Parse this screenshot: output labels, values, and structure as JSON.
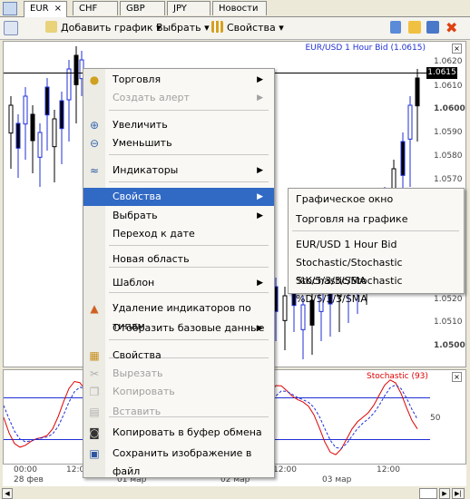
{
  "tabs": [
    "EUR",
    "CHF",
    "GBP",
    "JPY",
    "Новости"
  ],
  "tab_close_glyph": "×",
  "toolbar": {
    "add_chart": "Добавить график ▾",
    "select": "Выбрать ▾",
    "properties": "Свойства ▾"
  },
  "chart": {
    "title": "EUR/USD 1 Hour Bid (1.0615)",
    "y_ticks": [
      "1.0620",
      "1.0610",
      "1.0600",
      "1.0590",
      "1.0580",
      "1.0570",
      "1.0520",
      "1.0510",
      "1.0500"
    ],
    "price_badge": "1.0615",
    "oscillator_label": "Stochastic (93)",
    "oscillator_tick": "50",
    "x_ticks": [
      "00:00",
      "12:00",
      "12:00",
      "00:00",
      "12:00",
      "00:00",
      "12:00",
      "12:00",
      "12:00"
    ],
    "x_dates": [
      "28 фев",
      "01 мар",
      "02 мар",
      "03 мар"
    ]
  },
  "menu": {
    "items": [
      {
        "label": "Торговля",
        "submenu": true,
        "icon": "coins-icon"
      },
      {
        "label": "Создать алерт",
        "submenu": true,
        "disabled": true
      },
      {
        "label": "Увеличить",
        "icon": "zoom-in-icon"
      },
      {
        "label": "Уменьшить",
        "icon": "zoom-out-icon"
      },
      {
        "label": "Индикаторы",
        "submenu": true,
        "icon": "indicators-icon"
      },
      {
        "label": "Свойства",
        "submenu": true,
        "highlighted": true
      },
      {
        "label": "Выбрать",
        "submenu": true
      },
      {
        "label": "Переход к дате"
      },
      {
        "label": "Новая область"
      },
      {
        "label": "Шаблон",
        "submenu": true
      },
      {
        "label": "Удаление индикаторов по типам",
        "icon": "remove-indicators-icon"
      },
      {
        "label": "Отобразить базовые данные",
        "submenu": true
      },
      {
        "label": "Свойства",
        "icon": "properties-icon"
      },
      {
        "label": "Вырезать",
        "disabled": true,
        "icon": "cut-icon"
      },
      {
        "label": "Копировать",
        "disabled": true,
        "icon": "copy-icon"
      },
      {
        "label": "Вставить",
        "disabled": true,
        "icon": "paste-icon"
      },
      {
        "label": "Копировать в буфер обмена",
        "icon": "camera-icon"
      },
      {
        "label": "Сохранить изображение в файл",
        "icon": "save-icon"
      }
    ]
  },
  "submenu": {
    "items": [
      "Графическое окно",
      "Торговля на графике",
      "EUR/USD 1 Hour Bid",
      "Stochastic/Stochastic %K/5/3/3/SMA",
      "Stochastic/Stochastic %D/5/3/3/SMA"
    ]
  },
  "colors": {
    "highlight": "#316ac5",
    "candle_up": "#1f2fd6",
    "candle_down": "#000000",
    "stoch_k": "#e00000",
    "stoch_d": "#1f2fd6",
    "title": "#1f2fd6"
  }
}
